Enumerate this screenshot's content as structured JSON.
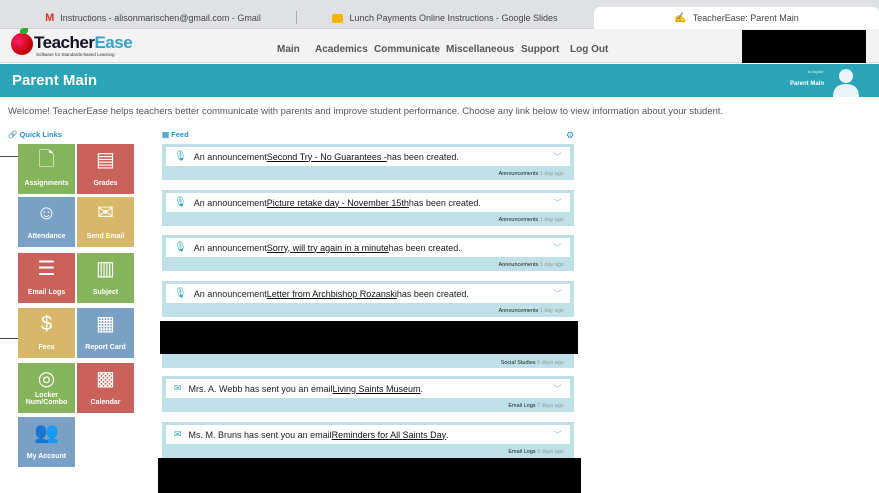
{
  "tabs": [
    {
      "label": "Instructions - alisonmarischen@gmail.com - Gmail",
      "icon": "gmail-icon"
    },
    {
      "label": "Lunch Payments Online Instructions - Google Slides",
      "icon": "slides-icon"
    },
    {
      "label": "TeacherEase: Parent Main",
      "icon": "teacherease-icon"
    }
  ],
  "logo": {
    "brand1": "Teacher",
    "brand2": "Ease",
    "tagline": "Software for Standards-based Learning"
  },
  "nav": [
    "Main",
    "Academics",
    "Communicate",
    "Miscellaneous",
    "Support",
    "Log Out"
  ],
  "banner": {
    "title": "Parent Main",
    "to_logout": "to logout",
    "user": "Parent Main"
  },
  "welcome": "Welcome! TeacherEase helps teachers better communicate with parents and improve student performance. Choose any link below to view information about your student.",
  "quick_links": {
    "heading": "Quick Links",
    "items": [
      {
        "label": "Assignments",
        "icon": "document-icon",
        "color": "#86b45c"
      },
      {
        "label": "Grades",
        "icon": "gradebook-icon",
        "color": "#c8625a"
      },
      {
        "label": "Attendance",
        "icon": "people-icon",
        "color": "#7aa1c5"
      },
      {
        "label": "Send Email",
        "icon": "envelope-icon",
        "color": "#d7b86a"
      },
      {
        "label": "Email Logs",
        "icon": "list-icon",
        "color": "#c8625a"
      },
      {
        "label": "Subject",
        "icon": "notebook-icon",
        "color": "#86b45c"
      },
      {
        "label": "Fees",
        "icon": "dollar-icon",
        "color": "#d7b86a"
      },
      {
        "label": "Report Card",
        "icon": "report-card-icon",
        "color": "#7aa1c5"
      },
      {
        "label": "Locker Num/Combo",
        "icon": "lock-dial-icon",
        "color": "#86b45c"
      },
      {
        "label": "Calendar",
        "icon": "calendar-icon",
        "color": "#c8625a"
      },
      {
        "label": "My Account",
        "icon": "users-icon",
        "color": "#7aa1c5"
      }
    ]
  },
  "feed": {
    "heading": "Feed",
    "items": [
      {
        "prefix": "An announcement ",
        "link": "Second Try - No Guarantees - ",
        "suffix": "has been created.",
        "category": "Announcements",
        "age": "1 day ago",
        "icon": "microphone-icon"
      },
      {
        "prefix": "An announcement ",
        "link": "Picture retake day - November 15th",
        "suffix": " has been created.",
        "category": "Announcements",
        "age": "1 day ago",
        "icon": "microphone-icon"
      },
      {
        "prefix": "An announcement ",
        "link": "Sorry, will try again in a minute",
        "suffix": " has been created.",
        "category": "Announcements",
        "age": "1 day ago",
        "icon": "microphone-icon"
      },
      {
        "prefix": "An announcement ",
        "link": "Letter from Archbishop Rozanski",
        "suffix": " has been created.",
        "category": "Announcements",
        "age": "1 day ago",
        "icon": "microphone-icon"
      },
      {
        "prefix": "Mrs. A. Webb has sent you an email ",
        "link": "Living Saints Museum",
        "suffix": ".",
        "category": "Email Logs",
        "age": "7 days ago",
        "icon": "envelope-icon"
      },
      {
        "prefix": "Ms. M. Bruns has sent you an email ",
        "link": "Reminders for All Saints Day",
        "suffix": ".",
        "category": "Email Logs",
        "age": "9 days ago",
        "icon": "envelope-icon"
      }
    ],
    "social": {
      "category": "Social Studies",
      "age": "6 days ago"
    }
  }
}
